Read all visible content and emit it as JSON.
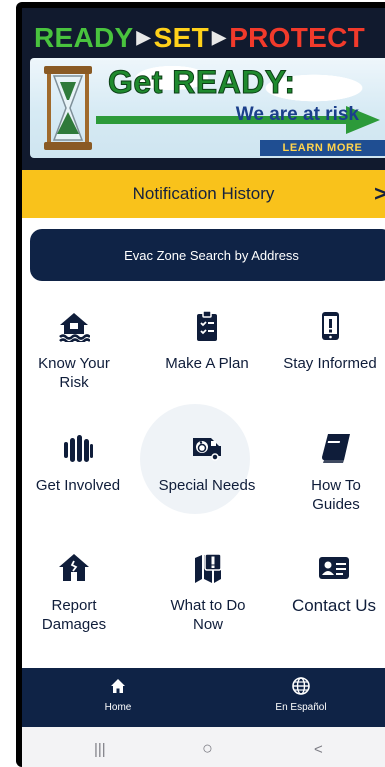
{
  "banner": {
    "word_ready": "READY",
    "word_set": "SET",
    "word_protect": "PROTECT",
    "headline": "Get READY:",
    "subline": "We are at risk",
    "learn_more": "LEARN MORE",
    "colors": {
      "ready": "#49c33e",
      "set": "#ffd11a",
      "protect": "#f23a2b"
    }
  },
  "notification": {
    "label": "Notification History",
    "chevron": ">"
  },
  "evac_button": {
    "label": "Evac Zone Search by Address"
  },
  "tiles": [
    {
      "id": "know-your-risk",
      "label_line1": "Know Your",
      "label_line2": "Risk",
      "icon": "house-flood-icon"
    },
    {
      "id": "make-a-plan",
      "label_line1": "Make A Plan",
      "label_line2": "",
      "icon": "clipboard-checklist-icon"
    },
    {
      "id": "stay-informed",
      "label_line1": "Stay Informed",
      "label_line2": "",
      "icon": "phone-alert-icon"
    },
    {
      "id": "get-involved",
      "label_line1": "Get Involved",
      "label_line2": "",
      "icon": "raised-hands-icon"
    },
    {
      "id": "special-needs",
      "label_line1": "Special Needs",
      "label_line2": "",
      "icon": "accessible-van-icon"
    },
    {
      "id": "how-to-guides",
      "label_line1": "How To",
      "label_line2": "Guides",
      "icon": "book-icon"
    },
    {
      "id": "report-damages",
      "label_line1": "Report",
      "label_line2": "Damages",
      "icon": "damaged-house-icon"
    },
    {
      "id": "what-to-do-now",
      "label_line1": "What to Do",
      "label_line2": "Now",
      "icon": "map-alert-icon"
    },
    {
      "id": "contact-us",
      "label_line1": "Contact Us",
      "label_line2": "",
      "icon": "contact-card-icon"
    }
  ],
  "bottom_nav": [
    {
      "label": "Home",
      "icon": "home-icon"
    },
    {
      "label": "En Español",
      "icon": "globe-icon"
    }
  ],
  "system_bar": {
    "recent": "|||",
    "home": "○",
    "back": "<"
  },
  "colors": {
    "navy": "#0f2346",
    "accent_yellow": "#f9c21b"
  }
}
